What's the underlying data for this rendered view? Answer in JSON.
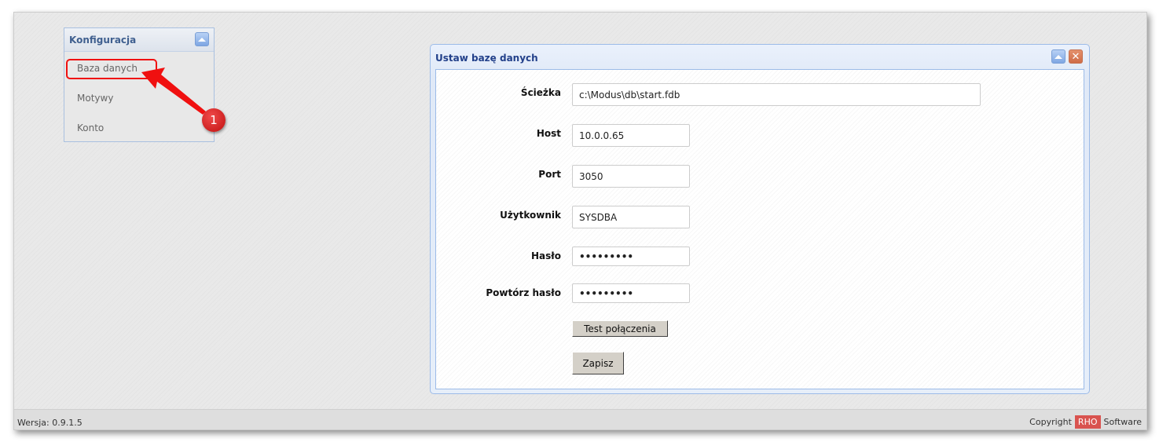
{
  "sidebar": {
    "title": "Konfiguracja",
    "items": [
      {
        "label": "Baza danych"
      },
      {
        "label": "Motywy"
      },
      {
        "label": "Konto"
      }
    ]
  },
  "dialog": {
    "title": "Ustaw bazę danych",
    "fields": {
      "path": {
        "label": "Ścieżka",
        "value": "c:\\Modus\\db\\start.fdb"
      },
      "host": {
        "label": "Host",
        "value": "10.0.0.65"
      },
      "port": {
        "label": "Port",
        "value": "3050"
      },
      "user": {
        "label": "Użytkownik",
        "value": "SYSDBA"
      },
      "password": {
        "label": "Hasło",
        "value": "•••••••••"
      },
      "password2": {
        "label": "Powtórz hasło",
        "value": "•••••••••"
      }
    },
    "test_button": "Test połączenia",
    "save_button": "Zapisz"
  },
  "footer": {
    "version": "Wersja: 0.9.1.5",
    "copyright": "Copyright",
    "brand": "RHO",
    "software": "Software"
  },
  "annotation": {
    "badge": "1"
  }
}
